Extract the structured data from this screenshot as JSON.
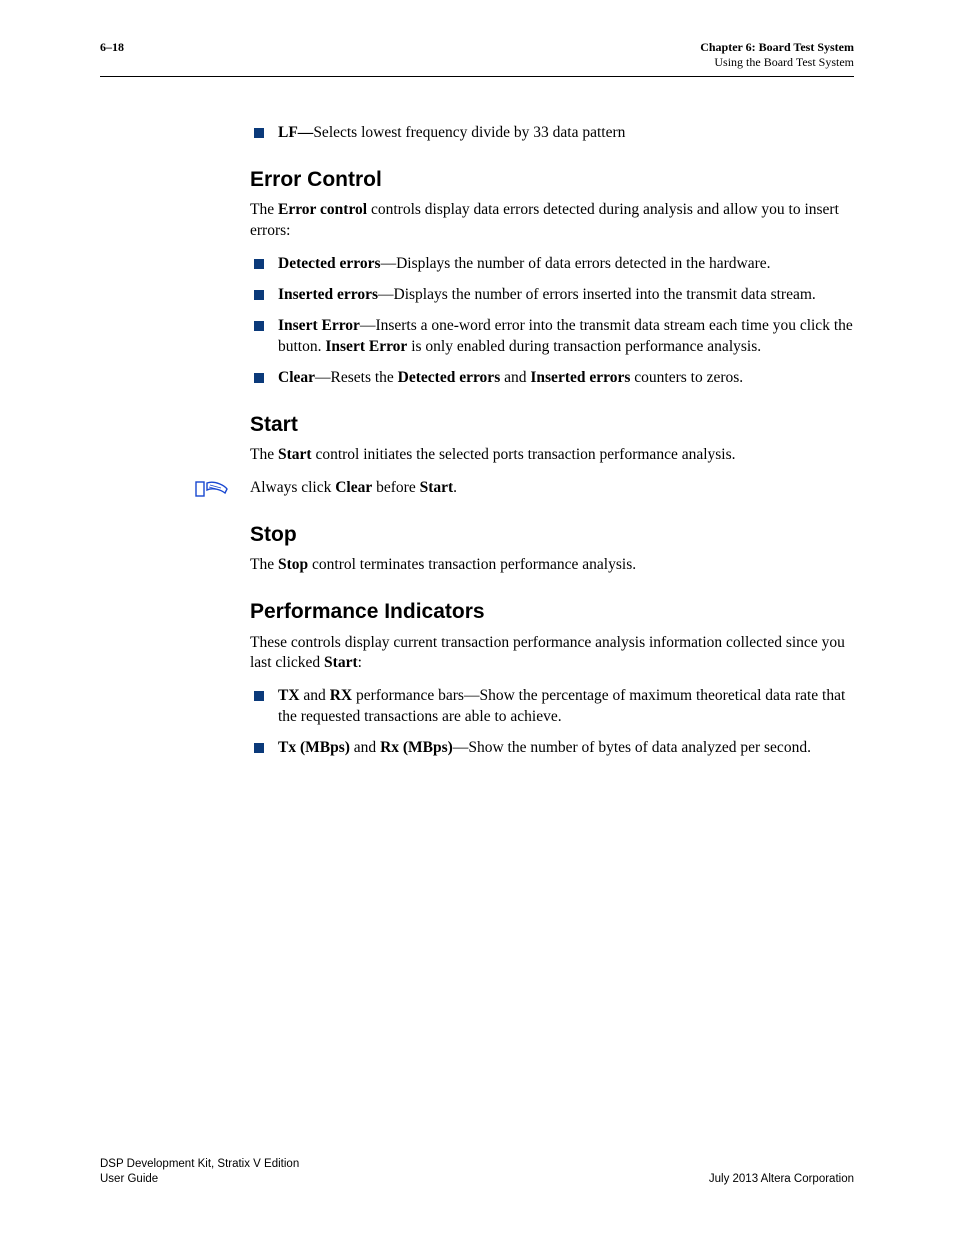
{
  "header": {
    "page_number": "6–18",
    "chapter": "Chapter 6:  Board Test System",
    "section": "Using the Board Test System"
  },
  "intro_bullet": {
    "term": "LF—",
    "desc": "Selects lowest frequency divide by 33 data pattern"
  },
  "error_control": {
    "heading": "Error Control",
    "intro_pre": "The ",
    "intro_bold": "Error control",
    "intro_post": " controls display data errors detected during analysis and allow you to insert errors:",
    "items": [
      {
        "term": "Detected errors",
        "desc": "—Displays the number of data errors detected in the hardware."
      },
      {
        "term": "Inserted errors",
        "desc": "—Displays the number of errors inserted into the transmit data stream."
      },
      {
        "term": "Insert Error",
        "desc_pre": "—Inserts a one-word error into the transmit data stream each time you click the button. ",
        "desc_bold": "Insert Error",
        "desc_post": " is only enabled during transaction performance analysis."
      }
    ],
    "clear": {
      "term": "Clear",
      "pre": "—Resets the ",
      "b1": "Detected errors",
      "mid": " and ",
      "b2": "Inserted errors",
      "post": " counters to zeros."
    }
  },
  "start": {
    "heading": "Start",
    "p_pre": "The ",
    "p_bold": "Start",
    "p_post": " control initiates the selected ports transaction performance analysis.",
    "note_pre": "Always click ",
    "note_b1": "Clear",
    "note_mid": " before ",
    "note_b2": "Start",
    "note_post": "."
  },
  "stop": {
    "heading": "Stop",
    "p_pre": "The ",
    "p_bold": "Stop",
    "p_post": " control terminates transaction performance analysis."
  },
  "perf": {
    "heading": "Performance Indicators",
    "intro_pre": "These controls display current transaction performance analysis information collected since you last clicked ",
    "intro_bold": "Start",
    "intro_post": ":",
    "item1": {
      "b1": "TX",
      "mid1": " and ",
      "b2": "RX",
      "post": " performance bars—Show the percentage of maximum theoretical data rate that the requested transactions are able to achieve."
    },
    "item2": {
      "b1": "Tx (MBps)",
      "mid1": " and ",
      "b2": "Rx (MBps)",
      "post": "—Show the number of bytes of data analyzed per second."
    }
  },
  "footer": {
    "left_line1": "DSP Development Kit, Stratix V Edition",
    "left_line2": "User Guide",
    "right": "July 2013   Altera Corporation"
  }
}
